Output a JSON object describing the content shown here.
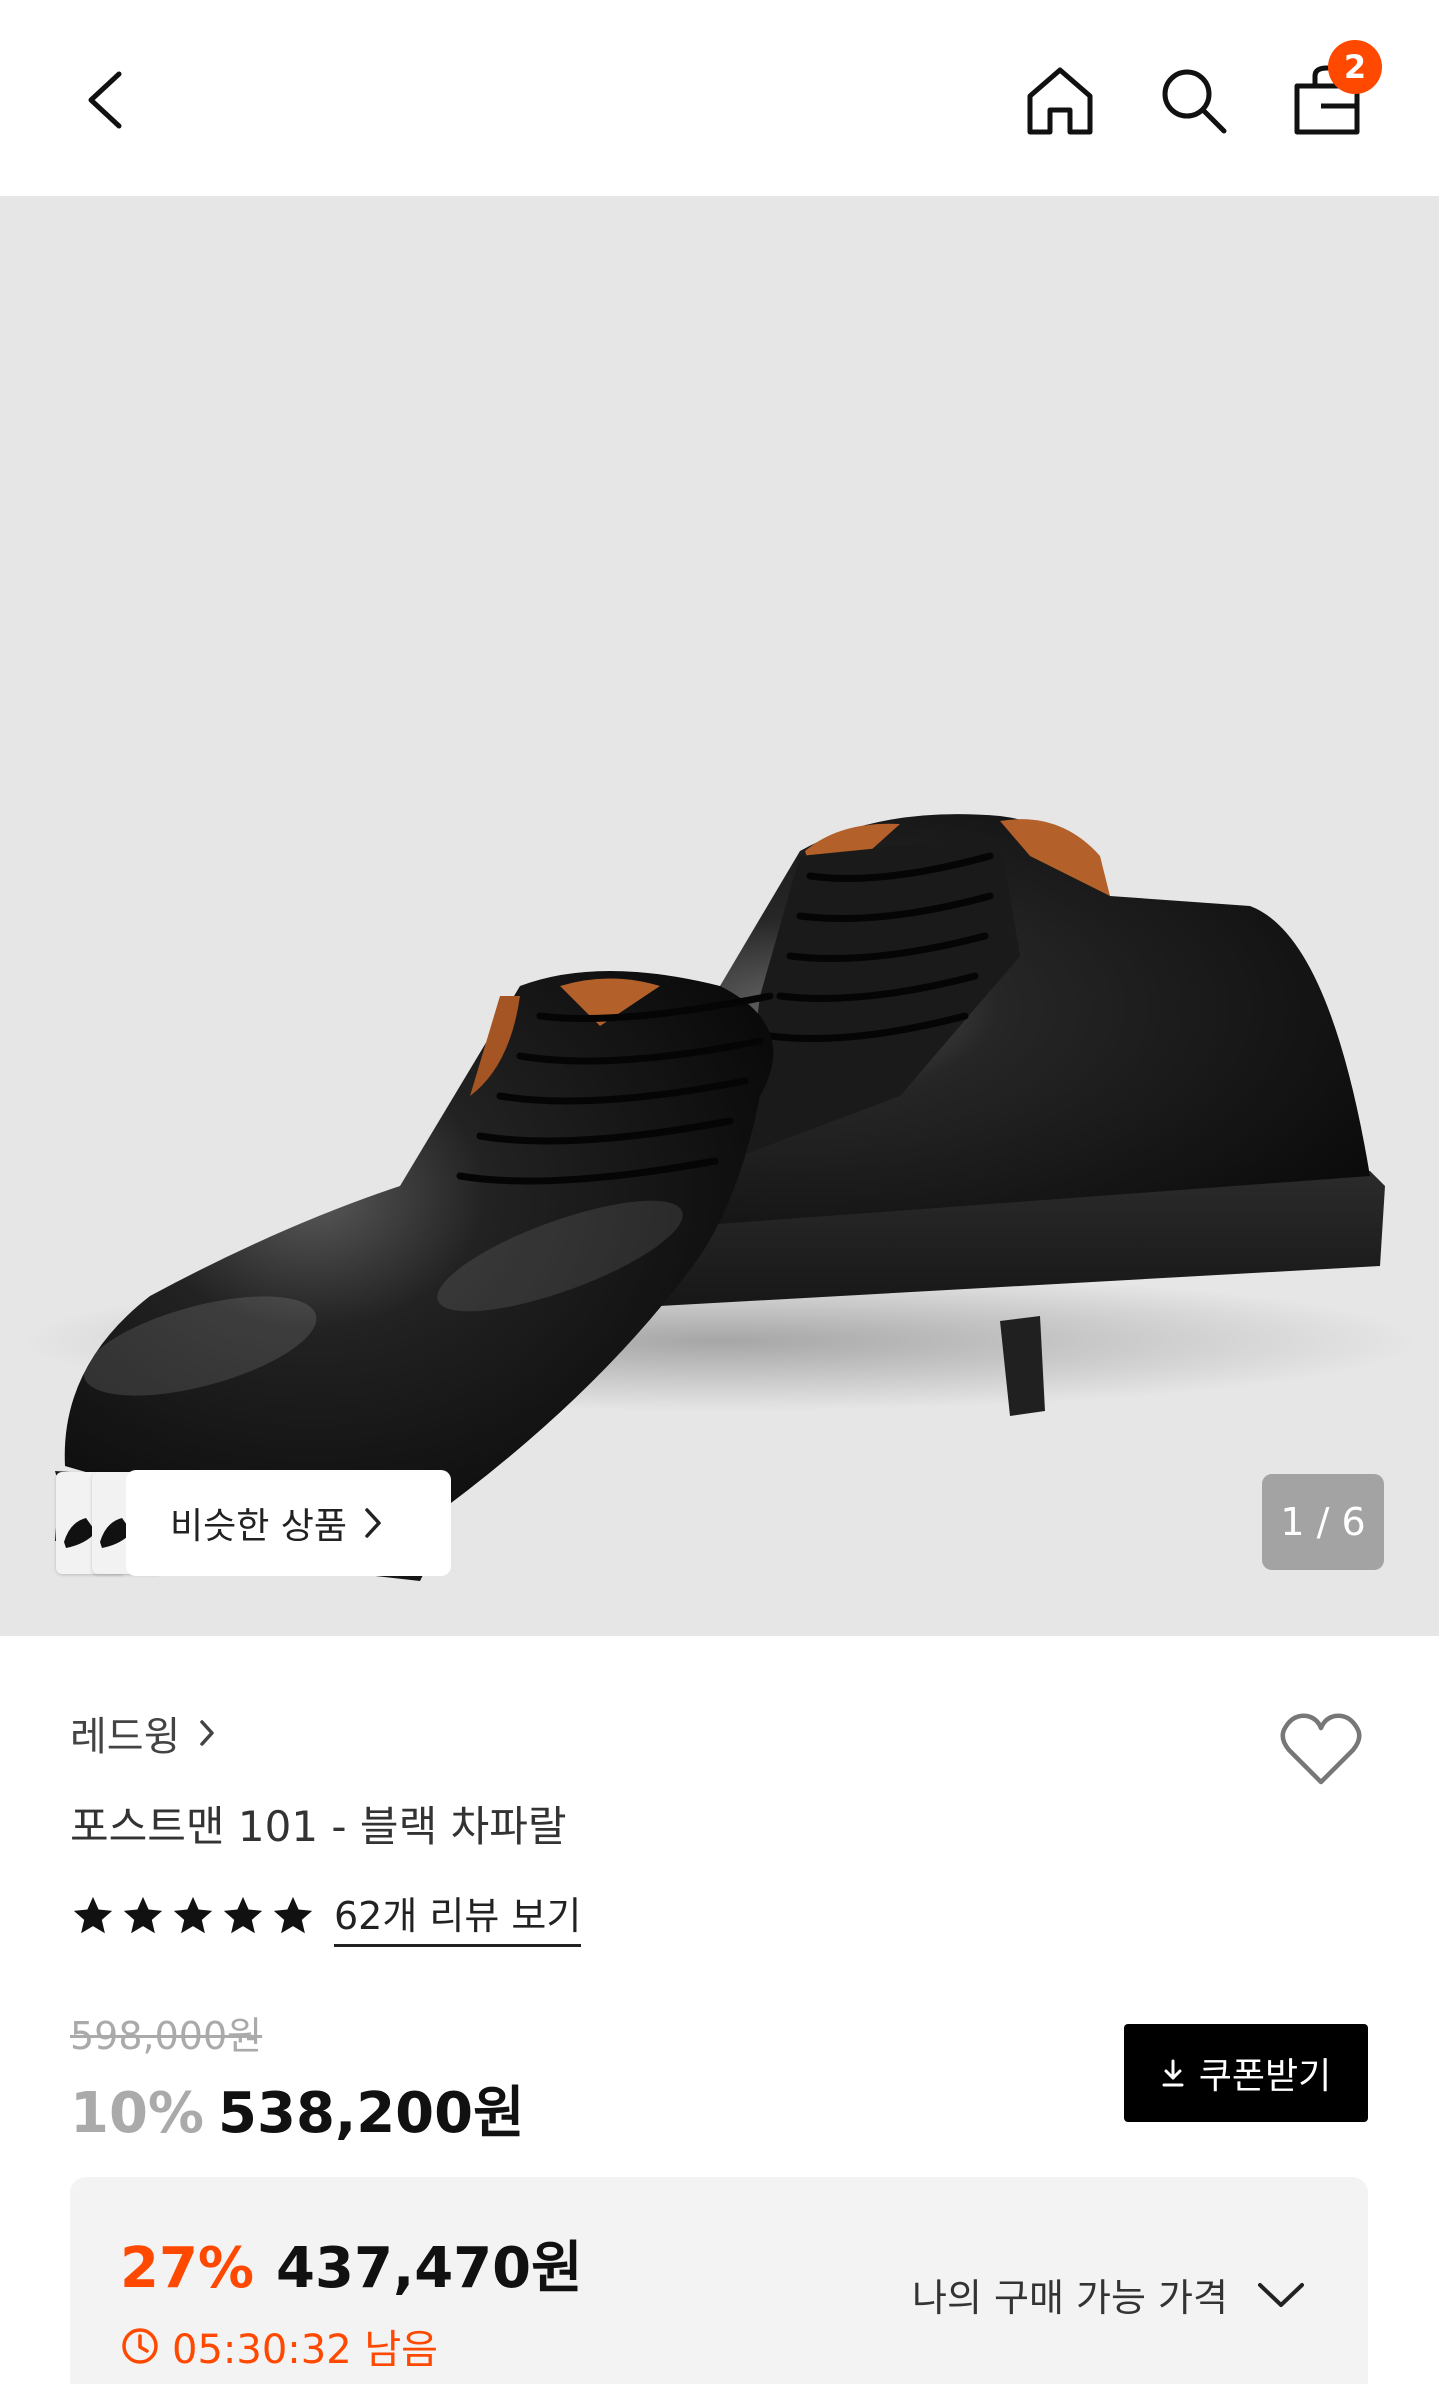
{
  "header": {
    "back_icon": "chevron-left-icon",
    "home_icon": "home-icon",
    "search_icon": "search-icon",
    "bag_icon": "shopping-bag-icon",
    "cart_count": "2",
    "badge_color": "#ff4800"
  },
  "hero": {
    "similar_label": "비슷한 상품",
    "pager": "1 / 6",
    "background": "#e6e6e6"
  },
  "product": {
    "brand": "레드윙",
    "name": "포스트맨 101 - 블랙 차파랄",
    "rating_stars": 5,
    "review_link": "62개 리뷰 보기",
    "original_price": "598,000원",
    "discount_rate": "10%",
    "sale_price": "538,200원",
    "coupon_label": "쿠폰받기"
  },
  "best_price": {
    "rate": "27%",
    "price": "437,470원",
    "timer": "05:30:32 남음",
    "my_price_label": "나의 구매 가능 가격",
    "accent": "#ff4800"
  }
}
